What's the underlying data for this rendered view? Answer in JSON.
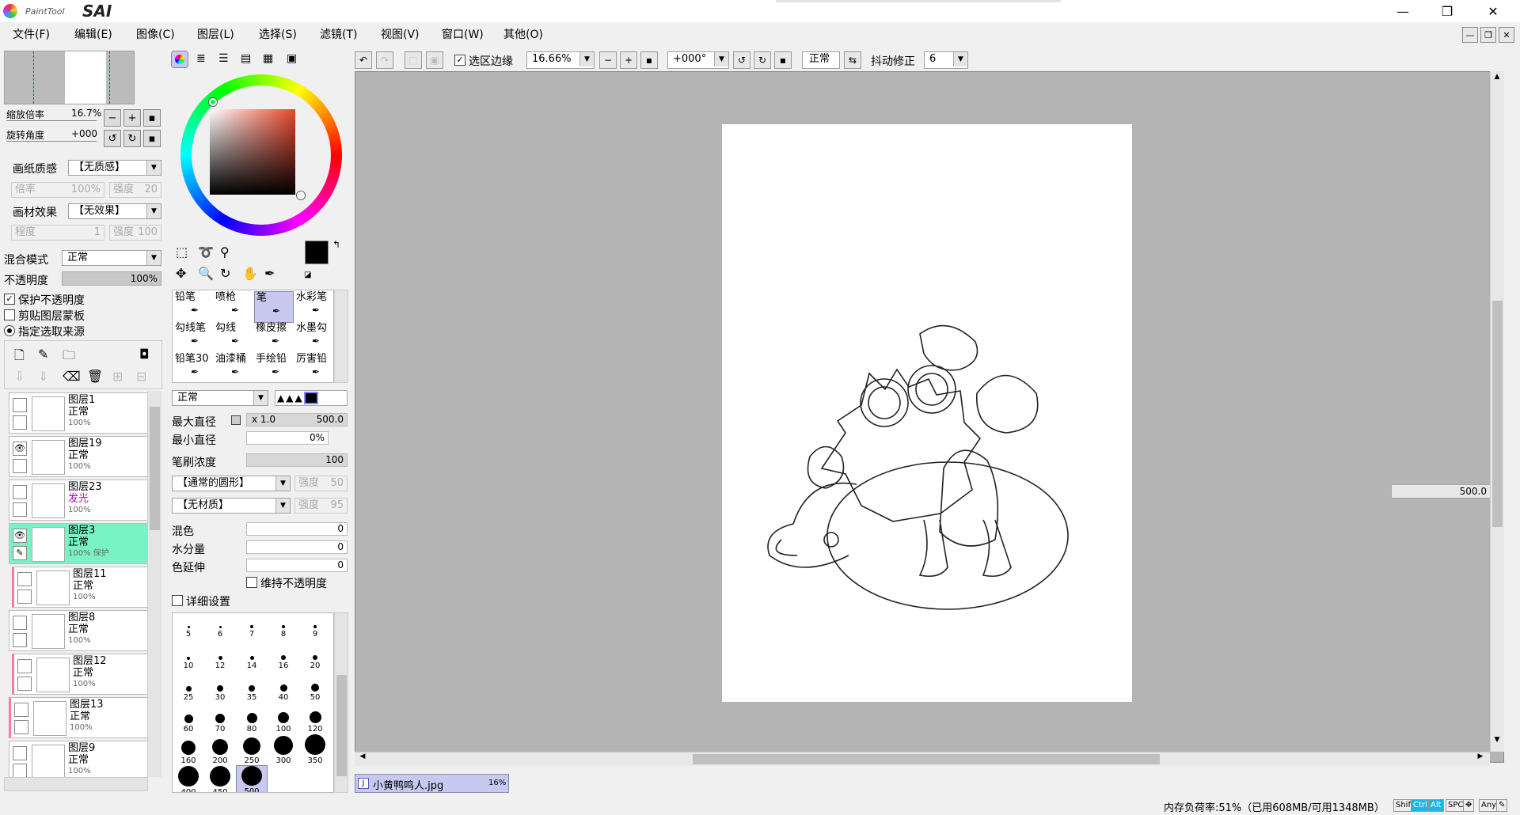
{
  "app": {
    "logo_small": "PaintTool",
    "logo_big": "SAI"
  },
  "window_buttons": {
    "minimize": "—",
    "restore": "❐",
    "close": "✕"
  },
  "menu": [
    "文件(F)",
    "编辑(E)",
    "图像(C)",
    "图层(L)",
    "选择(S)",
    "滤镜(T)",
    "视图(V)",
    "窗口(W)",
    "其他(O)"
  ],
  "navigator": {
    "zoom_label": "缩放倍率",
    "zoom_value": "16.7%",
    "rotate_label": "旋转角度",
    "rotate_value": "+000"
  },
  "paper": {
    "texture_label": "画纸质感",
    "texture_value": "【无质感】",
    "scale_label": "倍率",
    "scale_value": "100%",
    "strength_label": "强度",
    "strength_value": "20",
    "effect_label": "画材效果",
    "effect_value": "【无效果】",
    "degree_label": "程度",
    "degree_value": "1",
    "strength2_label": "强度",
    "strength2_value": "100"
  },
  "blend": {
    "mode_label": "混合模式",
    "mode_value": "正常",
    "opacity_label": "不透明度",
    "opacity_value": "100%"
  },
  "layer_options": {
    "protect": "保护不透明度",
    "clip": "剪贴图层蒙板",
    "source": "指定选取来源"
  },
  "layers": [
    {
      "name": "图层1",
      "mode": "正常",
      "opacity": "100%",
      "visible": false,
      "selected": false
    },
    {
      "name": "图层19",
      "mode": "正常",
      "opacity": "100%",
      "visible": true,
      "selected": false
    },
    {
      "name": "图层23",
      "mode": "发光",
      "opacity": "100%",
      "visible": false,
      "selected": false
    },
    {
      "name": "图层3",
      "mode": "正常",
      "opacity": "100% 保护",
      "visible": true,
      "selected": true
    },
    {
      "name": "图层11",
      "mode": "正常",
      "opacity": "100%",
      "visible": false,
      "selected": false
    },
    {
      "name": "图层8",
      "mode": "正常",
      "opacity": "100%",
      "visible": false,
      "selected": false
    },
    {
      "name": "图层12",
      "mode": "正常",
      "opacity": "100%",
      "visible": false,
      "selected": false
    },
    {
      "name": "图层13",
      "mode": "正常",
      "opacity": "100%",
      "visible": false,
      "selected": false
    },
    {
      "name": "图层9",
      "mode": "正常",
      "opacity": "100%",
      "visible": false,
      "selected": false
    }
  ],
  "colors": {
    "foreground": "#000000",
    "background": "#000000",
    "accent_layer": "#7af3c4",
    "glow_mode": "#c000c0"
  },
  "tools": [
    "铅笔",
    "喷枪",
    "笔",
    "水彩笔",
    "勾线笔",
    "勾线",
    "橡皮擦",
    "水墨勾",
    "铅笔30",
    "油漆桶",
    "手绘铅",
    "厉害铅"
  ],
  "brush": {
    "mode": "正常",
    "max_size_label": "最大直径",
    "max_size_mult": "x 1.0",
    "max_size_value": "500.0",
    "min_size_label": "最小直径",
    "min_size_value": "0%",
    "density_label": "笔刷浓度",
    "density_value": "100",
    "shape_value": "【通常的圆形】",
    "shape_strength_label": "强度",
    "shape_strength_value": "50",
    "texture_value": "【无材质】",
    "texture_strength_label": "强度",
    "texture_strength_value": "95",
    "mix_label": "混色",
    "mix_value": "0",
    "water_label": "水分量",
    "water_value": "0",
    "stretch_label": "色延伸",
    "stretch_value": "0",
    "keep_opacity_label": "维持不透明度",
    "detail_label": "详细设置"
  },
  "brush_sizes": [
    "5",
    "6",
    "7",
    "8",
    "9",
    "10",
    "12",
    "14",
    "16",
    "20",
    "25",
    "30",
    "35",
    "40",
    "50",
    "60",
    "70",
    "80",
    "100",
    "120",
    "160",
    "200",
    "250",
    "300",
    "350",
    "400",
    "450",
    "500"
  ],
  "selected_brush_size": "500",
  "toolbar": {
    "selection_edge_label": "选区边缘",
    "zoom_value": "16.66%",
    "rotate_value": "+000°",
    "mode_value": "正常",
    "stabilizer_label": "抖动修正",
    "stabilizer_value": "6"
  },
  "canvas_size_readout": "500.0",
  "document_tab": {
    "name": "小黄鸭鸣人.jpg",
    "zoom": "16%"
  },
  "status": {
    "memory": "内存负荷率:51%（已用608MB/可用1348MB）",
    "keys": [
      "Shift",
      "Ctrl",
      "Alt",
      "SPC",
      "✥",
      "Any",
      "✎"
    ],
    "keys_on": [
      "Ctrl",
      "Alt"
    ]
  }
}
